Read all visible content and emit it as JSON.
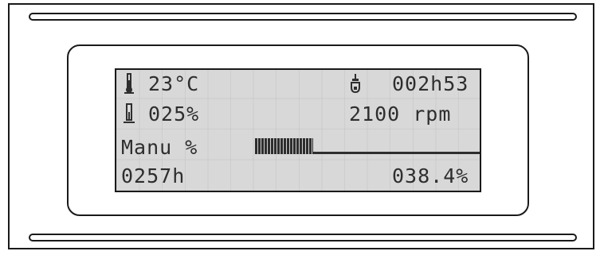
{
  "display": {
    "temperature": "23°C",
    "timer": "002h53",
    "load": "025%",
    "speed": "2100 rpm",
    "mode": "Manu %",
    "hours": "0257h",
    "percent": "038.4%",
    "bar_fill_fraction": 0.25
  },
  "icons": {
    "thermometer": "thermometer-icon",
    "timer": "hourglass-icon",
    "load": "bar-gauge-icon"
  },
  "colors": {
    "lcd_background": "#d8d8d8",
    "lcd_pixels": "#2e2e2e",
    "frame": "#1a1a1a"
  }
}
